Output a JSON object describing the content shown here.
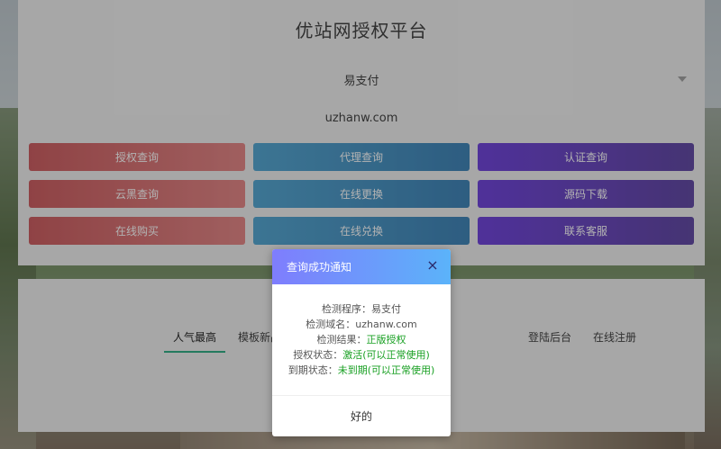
{
  "header": {
    "title": "优站网授权平台"
  },
  "select": {
    "value": "易支付"
  },
  "domain": {
    "value": "uzhanw.com"
  },
  "buttons": [
    {
      "label": "授权查询",
      "color": "red"
    },
    {
      "label": "代理查询",
      "color": "blue"
    },
    {
      "label": "认证查询",
      "color": "purple"
    },
    {
      "label": "云黑查询",
      "color": "red"
    },
    {
      "label": "在线更换",
      "color": "blue"
    },
    {
      "label": "源码下载",
      "color": "purple"
    },
    {
      "label": "在线购买",
      "color": "red"
    },
    {
      "label": "在线兑换",
      "color": "blue"
    },
    {
      "label": "联系客服",
      "color": "purple"
    }
  ],
  "tabs": [
    {
      "label": "人气最高"
    },
    {
      "label": "模板新品"
    },
    {
      "label": "登陆后台"
    },
    {
      "label": "在线注册"
    }
  ],
  "modal": {
    "title": "查询成功通知",
    "close_icon": "×",
    "lines": [
      {
        "label": "检测程序：",
        "value": "易支付"
      },
      {
        "label": "检测域名：",
        "value": "uzhanw.com"
      },
      {
        "label": "检测结果：",
        "value": "正版授权"
      },
      {
        "label": "授权状态：",
        "value": "激活(可以正常使用)"
      },
      {
        "label": "到期状态：",
        "value": "未到期(可以正常使用)"
      }
    ],
    "confirm_label": "好的"
  }
}
